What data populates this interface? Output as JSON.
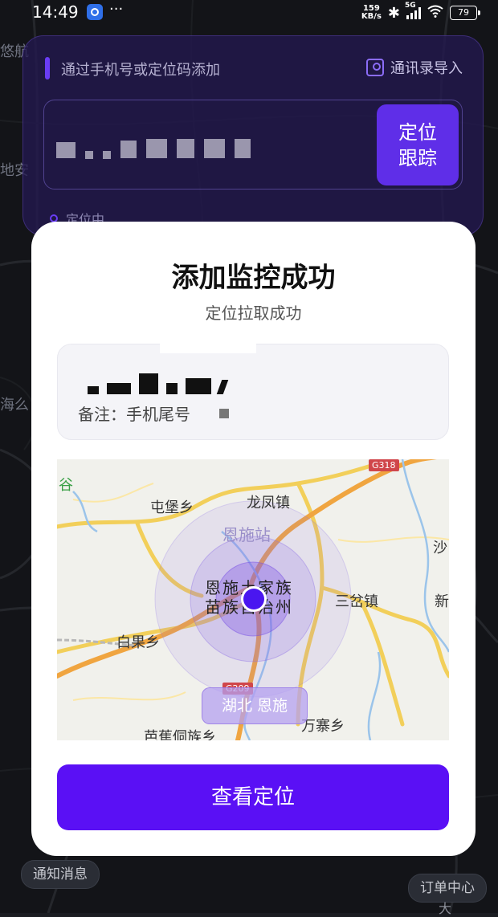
{
  "status_bar": {
    "time": "14:49",
    "dots": "···",
    "net_speed_value": "159",
    "net_speed_unit": "KB/s",
    "network": "5G",
    "battery": "79"
  },
  "background": {
    "input_hint": "通过手机号或定位码添加",
    "import_label": "通讯录导入",
    "track_button": "定位跟踪",
    "status": "定位中",
    "left_label_1": "悠航",
    "left_label_2": "地安",
    "left_label_3": "海么",
    "notify_button": "通知消息",
    "orders_button": "订单中心",
    "orders_below": "大"
  },
  "modal": {
    "title": "添加监控成功",
    "subtitle": "定位拉取成功",
    "note_label": "备注：手机尾号",
    "map": {
      "labels": {
        "gu": "谷",
        "tunbao": "屯堡乡",
        "longfeng": "龙凤镇",
        "enshi_station": "恩施站",
        "sha": "沙",
        "enshi_line1": "恩施土家族",
        "enshi_line2": "苗族自治州",
        "sancha": "三岔镇",
        "xin": "新",
        "baiguo": "白果乡",
        "wanzhai": "万寨乡",
        "bajiao": "芭蕉侗族乡"
      },
      "road_g318": "G318",
      "road_g209": "G209",
      "location_pill": "湖北 恩施"
    },
    "view_button": "查看定位"
  },
  "colors": {
    "accent": "#5a10f5",
    "panel": "#221850",
    "pin": "#4a16f0"
  }
}
